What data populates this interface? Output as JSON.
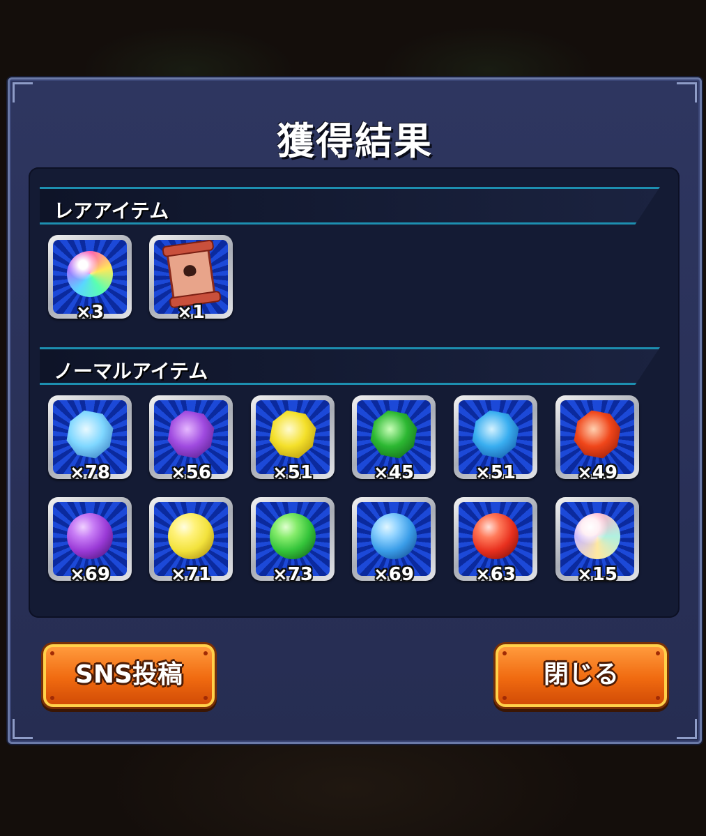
{
  "dialog": {
    "title": "獲得結果"
  },
  "rare_section": {
    "title": "レアアイテム",
    "items": [
      {
        "icon": "rainbow-orb-icon",
        "qty": "×3"
      },
      {
        "icon": "scroll-icon",
        "qty": "×1"
      }
    ]
  },
  "normal_section": {
    "title": "ノーマルアイテム",
    "crystals": [
      {
        "icon": "light-crystal-icon",
        "color": "#7fd7ff",
        "qty": "×78"
      },
      {
        "icon": "dark-crystal-icon",
        "color": "#a04be0",
        "qty": "×56"
      },
      {
        "icon": "yellow-crystal-icon",
        "color": "#f4e02a",
        "qty": "×51"
      },
      {
        "icon": "green-crystal-icon",
        "color": "#2cb832",
        "qty": "×45"
      },
      {
        "icon": "blue-crystal-icon",
        "color": "#39aef0",
        "qty": "×51"
      },
      {
        "icon": "red-crystal-icon",
        "color": "#f0461a",
        "qty": "×49"
      }
    ],
    "orbs": [
      {
        "icon": "dark-orb-icon",
        "color": "#9a3ad6",
        "qty": "×69"
      },
      {
        "icon": "yellow-orb-icon",
        "color": "#f2e23c",
        "qty": "×71"
      },
      {
        "icon": "green-orb-icon",
        "color": "#34c43a",
        "qty": "×73"
      },
      {
        "icon": "blue-orb-icon",
        "color": "#3a9de8",
        "qty": "×69"
      },
      {
        "icon": "red-orb-icon",
        "color": "#e8301e",
        "qty": "×63"
      },
      {
        "icon": "light-orb-icon",
        "color": "#f4d2d8",
        "qty": "×15"
      }
    ]
  },
  "buttons": {
    "sns": "SNS投稿",
    "close": "閉じる"
  }
}
